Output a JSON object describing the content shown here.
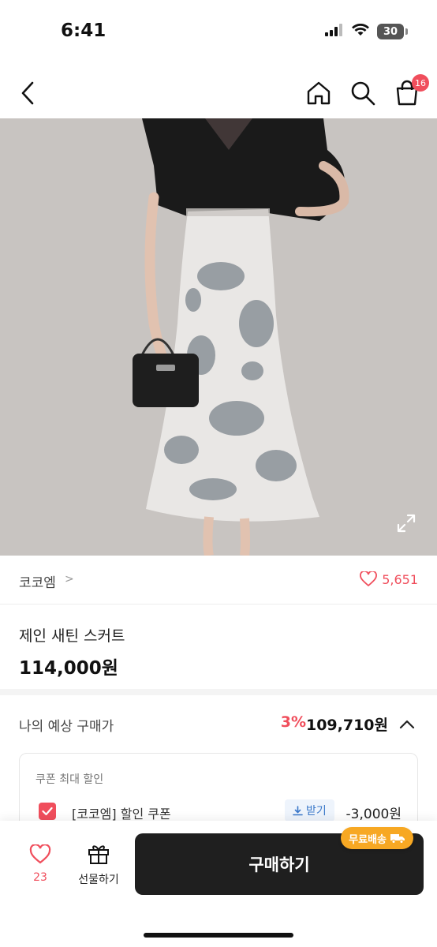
{
  "status": {
    "time": "6:41",
    "battery": "30"
  },
  "nav": {
    "cart_count": "16"
  },
  "brand": {
    "name": "코코엠",
    "chevron": ">",
    "likes": "5,651"
  },
  "product": {
    "title": "제인 새틴 스커트",
    "price": "114,000원"
  },
  "estimate": {
    "label": "나의 예상 구매가",
    "discount": "3%",
    "price": "109,710원"
  },
  "coupon": {
    "header": "쿠폰 최대 할인",
    "name": "[코코엠] 할인 쿠폰",
    "get_label": "받기",
    "amount": "-3,000원"
  },
  "bottom": {
    "wish_count": "23",
    "gift_label": "선물하기",
    "buy_label": "구매하기",
    "free_shipping": "무료배송"
  },
  "colors": {
    "accent": "#f04e5c",
    "buy_button": "#1f1f1f",
    "shipping_badge": "#f7a823"
  }
}
